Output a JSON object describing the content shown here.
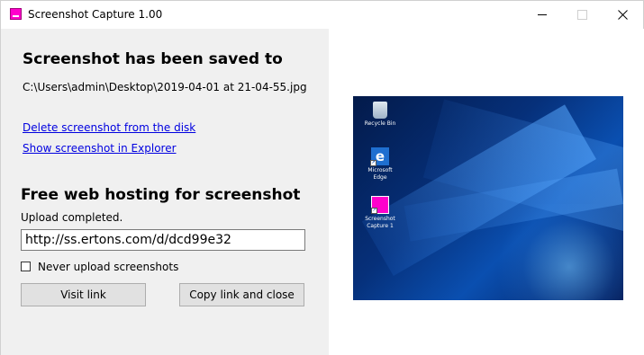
{
  "window": {
    "title": "Screenshot Capture 1.00"
  },
  "saved": {
    "heading": "Screenshot has been saved to",
    "path": "C:\\Users\\admin\\Desktop\\2019-04-01 at 21-04-55.jpg",
    "delete_link": "Delete screenshot from the disk",
    "explorer_link": "Show screenshot in Explorer"
  },
  "hosting": {
    "heading": "Free web hosting for screenshot",
    "status": "Upload completed.",
    "url": "http://ss.ertons.com/d/dcd99e32",
    "never_upload_label": "Never upload screenshots",
    "never_upload_checked": false,
    "visit_button": "Visit link",
    "copy_button": "Copy link and close"
  },
  "preview": {
    "icons": [
      {
        "label": "Recycle Bin",
        "icon": "recycle-bin-icon"
      },
      {
        "label": "Microsoft Edge",
        "icon": "edge-icon"
      },
      {
        "label": "Screenshot Capture 1",
        "icon": "screenshot-capture-icon"
      }
    ]
  },
  "colors": {
    "link": "#0000e0",
    "app_accent": "#ff00cc",
    "panel_bg": "#f0f0f0"
  }
}
